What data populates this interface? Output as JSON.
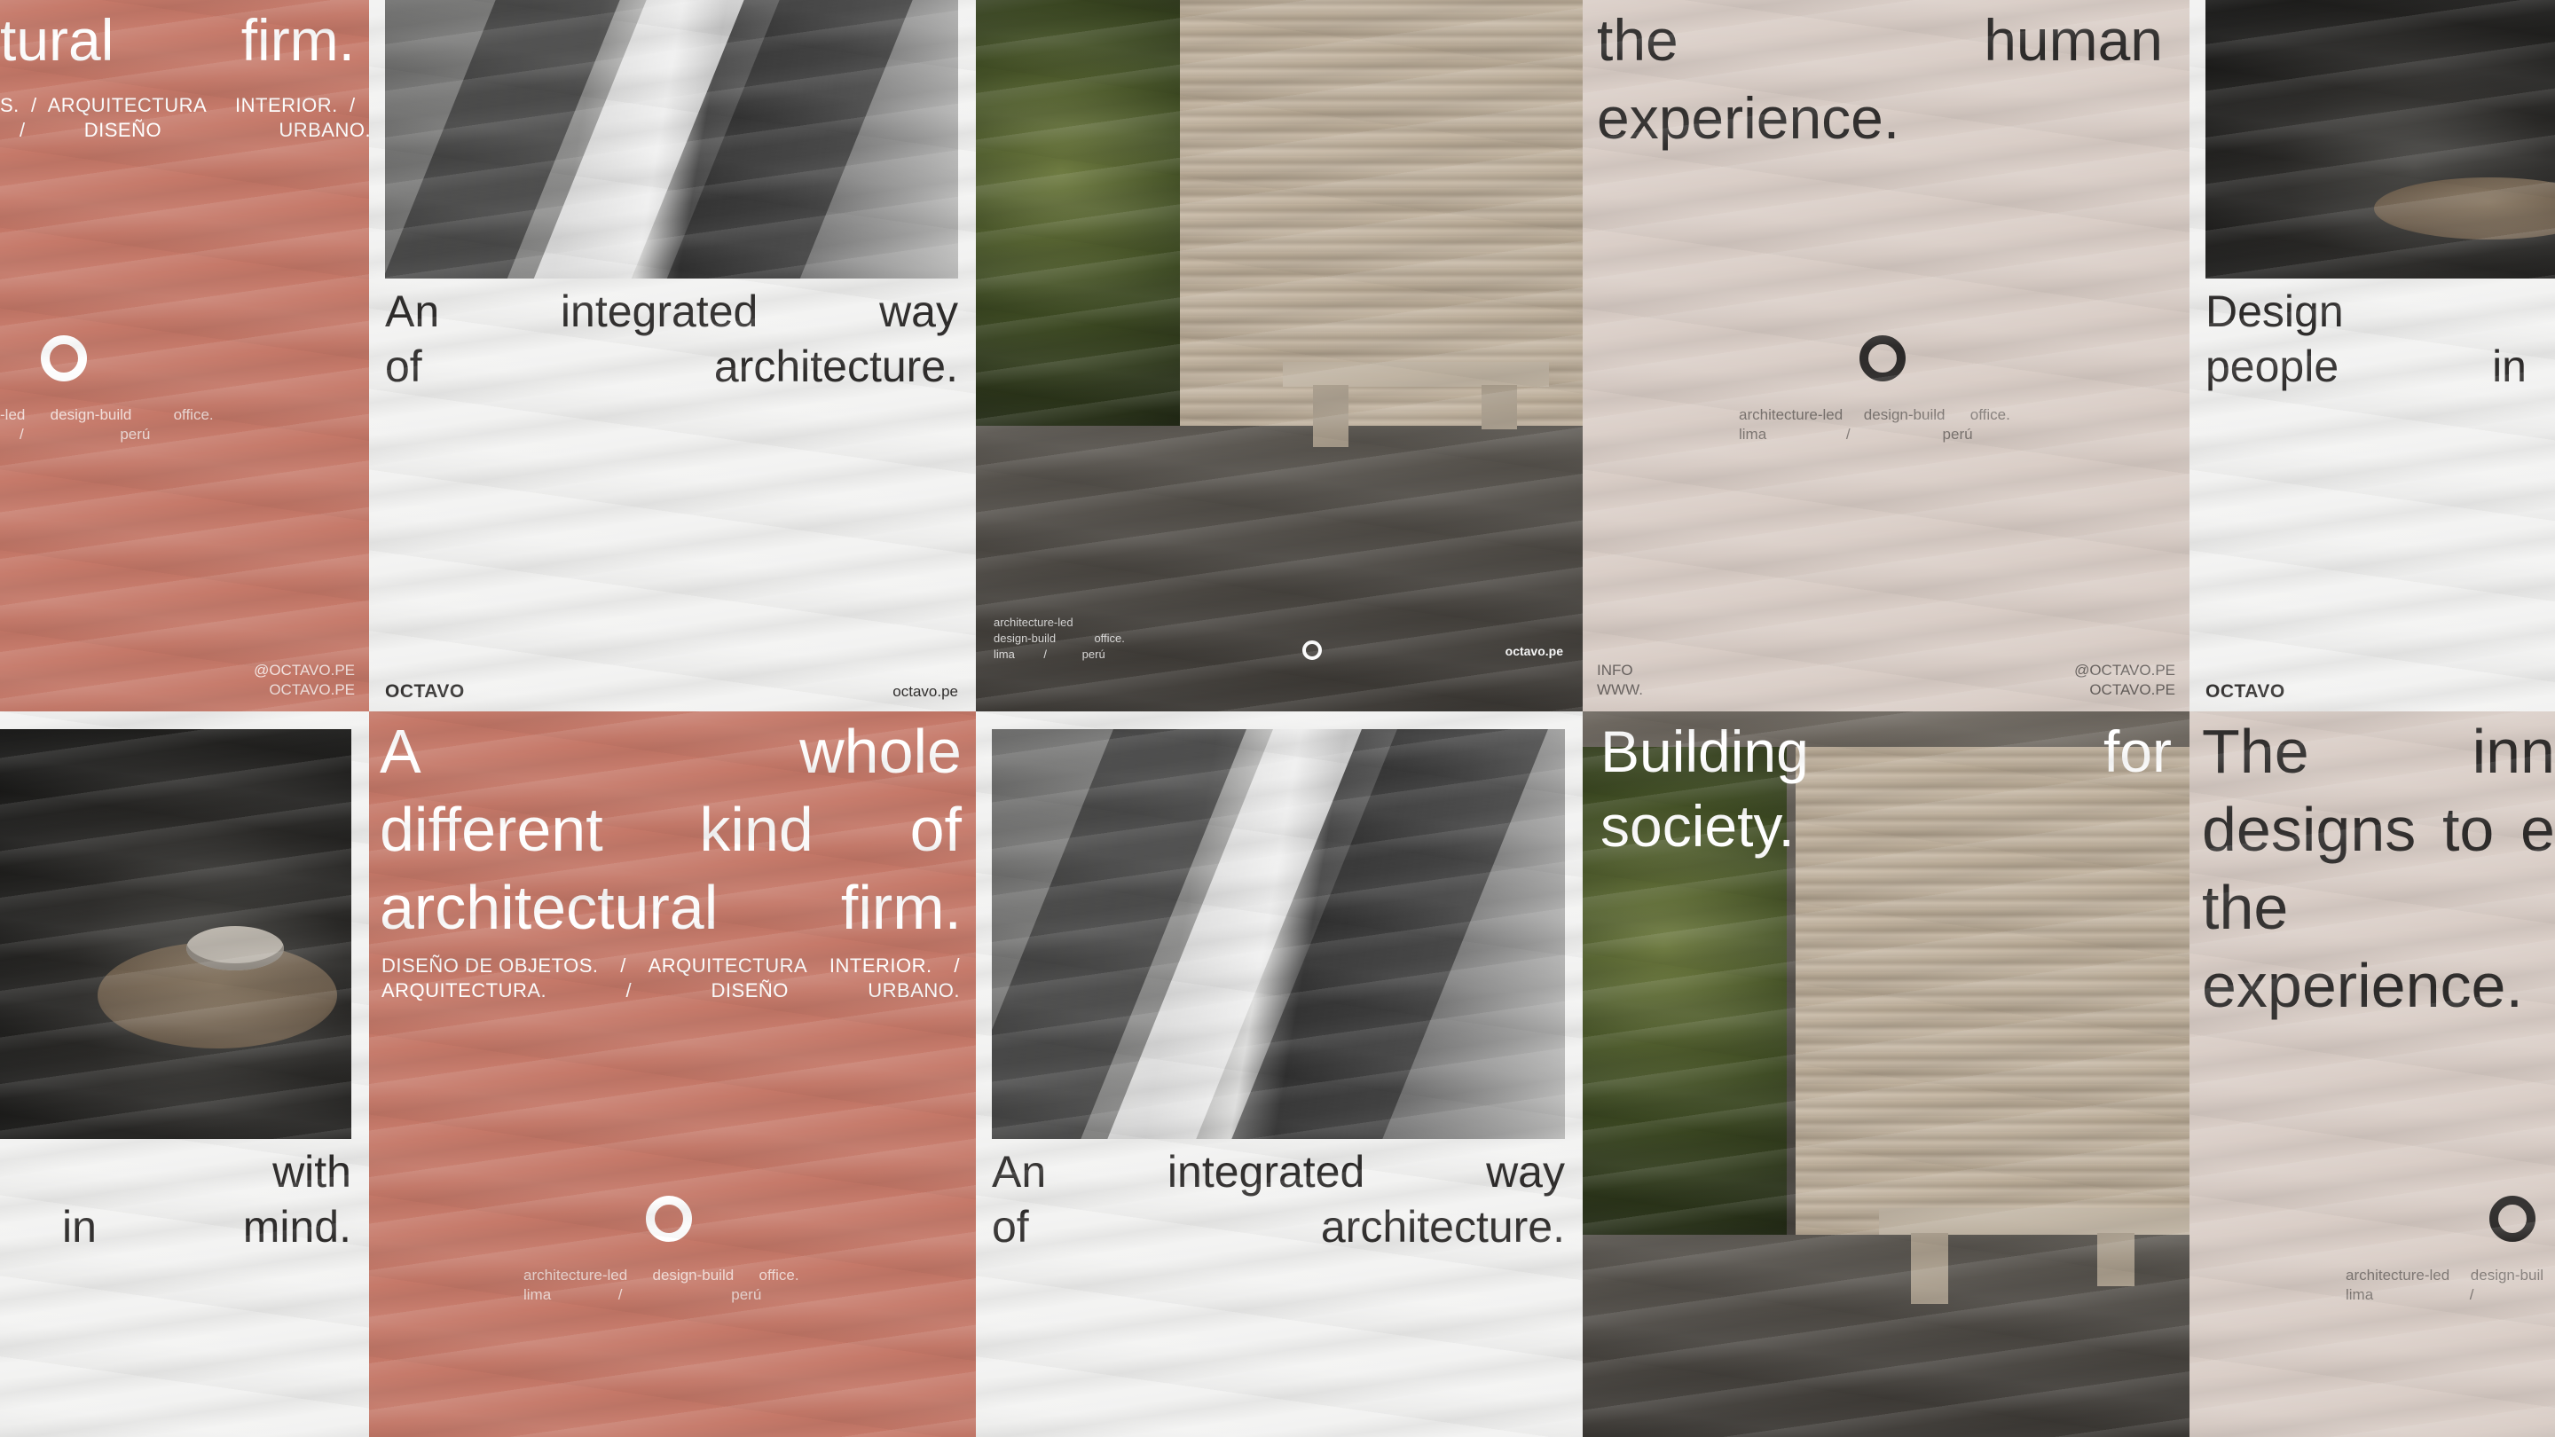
{
  "posters": {
    "p1": {
      "headline_a": "tural",
      "headline_b": "firm.",
      "subline_1": "S.  /  ARQUITECTURA     INTERIOR.  /",
      "subline_2": "/          DISEÑO                    URBANO.",
      "tag_1": "-led      design-build          office.",
      "tag_2": "/                       perú",
      "handle_1": "@OCTAVO.PE",
      "handle_2": "OCTAVO.PE"
    },
    "p2": {
      "line1": [
        "An",
        "integrated",
        "way"
      ],
      "line2": [
        "of",
        "architecture."
      ],
      "logo": "OCTAVO",
      "url": "octavo.pe"
    },
    "p3": {
      "tag_1": "architecture-led",
      "tag_2": "design-build            office.",
      "tag_3": "lima         /           perú",
      "url": "octavo.pe"
    },
    "p4": {
      "line1": [
        "the",
        "human"
      ],
      "line2": [
        "experience."
      ],
      "tag_1": "architecture-led     design-build      office.",
      "tag_2": "lima                   /                      perú",
      "info_1": "INFO",
      "info_2": "WWW.",
      "handle_1": "@OCTAVO.PE",
      "handle_2": "OCTAVO.PE"
    },
    "p5": {
      "line1": [
        "Design"
      ],
      "line2": [
        "people",
        "in"
      ],
      "logo": "OCTAVO"
    },
    "p6": {
      "line1": [
        "with"
      ],
      "line2": [
        "in",
        "mind."
      ]
    },
    "p7": {
      "line1": [
        "A",
        "whole"
      ],
      "line2": [
        "different",
        "kind",
        "of"
      ],
      "line3": [
        "architectural",
        "firm."
      ],
      "sub_1": [
        "DISEÑO DE OBJETOS.",
        "/",
        "ARQUITECTURA",
        "INTERIOR.",
        "/"
      ],
      "sub_2": [
        "ARQUITECTURA.",
        "/",
        "DISEÑO",
        "URBANO."
      ],
      "tag_1": "architecture-led      design-build      office.",
      "tag_2": "lima                /                          perú"
    },
    "p8": {
      "line1": [
        "An",
        "integrated",
        "way"
      ],
      "line2": [
        "of",
        "architecture."
      ]
    },
    "p9": {
      "line1": [
        "Building",
        "for"
      ],
      "line2": [
        "society."
      ]
    },
    "p10": {
      "line1": [
        "The",
        "inn"
      ],
      "line2": [
        "designs",
        "to",
        "e"
      ],
      "line3": [
        "the"
      ],
      "line4": [
        "experience."
      ],
      "tag_1": "architecture-led     design-buil",
      "tag_2": "lima                       /"
    }
  },
  "colors": {
    "pink": "#c57868",
    "white_poster": "#f2f2f1",
    "beige": "#d9cdc6",
    "text_dark": "#2d2b2a",
    "text_light": "#ffffff"
  }
}
